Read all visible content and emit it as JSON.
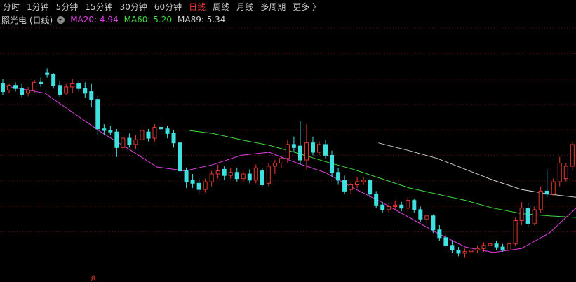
{
  "toolbar": {
    "tabs": [
      {
        "label": "分时"
      },
      {
        "label": "1分钟"
      },
      {
        "label": "5分钟"
      },
      {
        "label": "15分钟"
      },
      {
        "label": "30分钟"
      },
      {
        "label": "60分钟"
      },
      {
        "label": "日线",
        "active": true
      },
      {
        "label": "周线"
      },
      {
        "label": "月线"
      },
      {
        "label": "多周期"
      },
      {
        "label": "更多 〉"
      }
    ]
  },
  "info": {
    "stock_label": "照光电 (日线)",
    "ma20": {
      "label": "MA20: 4.94",
      "color": "#e040e0"
    },
    "ma60": {
      "label": "MA60: 5.20",
      "color": "#3fd93f"
    },
    "ma89": {
      "label": "MA89: 5.34",
      "color": "#cfcfcf"
    }
  },
  "colors": {
    "up": "#e8382f",
    "down": "#3ee0e0",
    "grid": "#7a1010"
  },
  "chart_data": {
    "type": "candlestick",
    "candles": [
      [
        6.22,
        6.28,
        6.08,
        6.12
      ],
      [
        6.14,
        6.22,
        6.1,
        6.2
      ],
      [
        6.2,
        6.24,
        6.12,
        6.16
      ],
      [
        6.16,
        6.22,
        6.05,
        6.08
      ],
      [
        6.1,
        6.18,
        6.06,
        6.14
      ],
      [
        6.14,
        6.27,
        6.1,
        6.24
      ],
      [
        6.24,
        6.3,
        6.18,
        6.22
      ],
      [
        6.36,
        6.42,
        6.3,
        6.34
      ],
      [
        6.34,
        6.36,
        6.16,
        6.2
      ],
      [
        6.2,
        6.26,
        6.05,
        6.08
      ],
      [
        6.1,
        6.22,
        6.08,
        6.18
      ],
      [
        6.18,
        6.28,
        6.1,
        6.22
      ],
      [
        6.22,
        6.26,
        6.12,
        6.16
      ],
      [
        6.16,
        6.24,
        6.04,
        6.1
      ],
      [
        6.12,
        6.22,
        5.92,
        6.02
      ],
      [
        6.02,
        6.06,
        5.56,
        5.64
      ],
      [
        5.64,
        5.7,
        5.56,
        5.62
      ],
      [
        5.62,
        5.68,
        5.56,
        5.6
      ],
      [
        5.6,
        5.64,
        5.28,
        5.4
      ],
      [
        5.4,
        5.56,
        5.36,
        5.52
      ],
      [
        5.52,
        5.58,
        5.4,
        5.44
      ],
      [
        5.44,
        5.56,
        5.38,
        5.5
      ],
      [
        5.5,
        5.66,
        5.46,
        5.62
      ],
      [
        5.6,
        5.64,
        5.48,
        5.52
      ],
      [
        5.52,
        5.7,
        5.48,
        5.66
      ],
      [
        5.66,
        5.72,
        5.6,
        5.64
      ],
      [
        5.64,
        5.68,
        5.52,
        5.58
      ],
      [
        5.58,
        5.62,
        5.4,
        5.46
      ],
      [
        5.46,
        5.48,
        5.02,
        5.1
      ],
      [
        5.1,
        5.14,
        4.88,
        4.96
      ],
      [
        4.98,
        5.06,
        4.88,
        4.94
      ],
      [
        4.94,
        5.0,
        4.8,
        4.86
      ],
      [
        4.86,
        5.0,
        4.82,
        4.96
      ],
      [
        4.96,
        5.1,
        4.9,
        5.06
      ],
      [
        5.06,
        5.18,
        5.0,
        5.1
      ],
      [
        5.12,
        5.16,
        4.98,
        5.04
      ],
      [
        5.04,
        5.14,
        5.0,
        5.08
      ],
      [
        5.08,
        5.14,
        4.96,
        5.0
      ],
      [
        5.0,
        5.1,
        4.96,
        5.06
      ],
      [
        5.06,
        5.12,
        4.94,
        4.98
      ],
      [
        4.98,
        5.18,
        4.94,
        5.14
      ],
      [
        5.1,
        5.14,
        4.9,
        4.92
      ],
      [
        4.94,
        5.2,
        4.9,
        5.16
      ],
      [
        5.16,
        5.24,
        5.06,
        5.2
      ],
      [
        5.2,
        5.3,
        5.14,
        5.26
      ],
      [
        5.26,
        5.5,
        5.2,
        5.44
      ],
      [
        5.44,
        5.54,
        5.34,
        5.4
      ],
      [
        5.42,
        5.74,
        5.18,
        5.24
      ],
      [
        5.24,
        5.7,
        5.12,
        5.46
      ],
      [
        5.46,
        5.54,
        5.3,
        5.34
      ],
      [
        5.34,
        5.48,
        5.3,
        5.44
      ],
      [
        5.44,
        5.5,
        5.26,
        5.3
      ],
      [
        5.3,
        5.36,
        5.02,
        5.08
      ],
      [
        5.08,
        5.14,
        4.92,
        4.98
      ],
      [
        4.98,
        5.04,
        4.8,
        4.84
      ],
      [
        4.86,
        4.96,
        4.8,
        4.92
      ],
      [
        4.92,
        5.02,
        4.88,
        4.96
      ],
      [
        4.96,
        5.02,
        4.92,
        4.98
      ],
      [
        4.98,
        5.0,
        4.76,
        4.8
      ],
      [
        4.8,
        4.84,
        4.62,
        4.66
      ],
      [
        4.66,
        4.7,
        4.56,
        4.6
      ],
      [
        4.6,
        4.68,
        4.56,
        4.64
      ],
      [
        4.64,
        4.72,
        4.6,
        4.66
      ],
      [
        4.66,
        4.7,
        4.58,
        4.62
      ],
      [
        4.62,
        4.76,
        4.6,
        4.72
      ],
      [
        4.72,
        4.74,
        4.56,
        4.6
      ],
      [
        4.6,
        4.64,
        4.44,
        4.48
      ],
      [
        4.48,
        4.54,
        4.4,
        4.52
      ],
      [
        4.52,
        4.54,
        4.3,
        4.34
      ],
      [
        4.34,
        4.4,
        4.2,
        4.24
      ],
      [
        4.24,
        4.3,
        4.1,
        4.14
      ],
      [
        4.14,
        4.2,
        4.04,
        4.08
      ],
      [
        4.08,
        4.12,
        4.0,
        4.04
      ],
      [
        4.04,
        4.1,
        3.98,
        4.06
      ],
      [
        4.06,
        4.12,
        4.02,
        4.08
      ],
      [
        4.08,
        4.14,
        4.04,
        4.1
      ],
      [
        4.1,
        4.18,
        4.06,
        4.14
      ],
      [
        4.14,
        4.2,
        4.1,
        4.16
      ],
      [
        4.16,
        4.2,
        4.08,
        4.12
      ],
      [
        4.12,
        4.16,
        4.06,
        4.08
      ],
      [
        4.08,
        4.18,
        4.04,
        4.16
      ],
      [
        4.16,
        4.5,
        4.14,
        4.46
      ],
      [
        4.46,
        4.7,
        4.4,
        4.62
      ],
      [
        4.62,
        4.68,
        4.38,
        4.42
      ],
      [
        4.42,
        4.64,
        4.4,
        4.6
      ],
      [
        4.6,
        4.9,
        4.56,
        4.84
      ],
      [
        4.84,
        5.12,
        4.76,
        4.8
      ],
      [
        4.8,
        5.0,
        4.78,
        4.96
      ],
      [
        4.96,
        5.28,
        4.9,
        5.2
      ],
      [
        5.0,
        5.2,
        4.96,
        5.16
      ],
      [
        5.16,
        5.48,
        5.1,
        5.44
      ],
      [
        5.44,
        5.58,
        5.3,
        5.34
      ]
    ],
    "ma20": [
      [
        0,
        6.2
      ],
      [
        30,
        6.1
      ],
      [
        50,
        5.85
      ],
      [
        70,
        5.6
      ],
      [
        90,
        5.38
      ],
      [
        110,
        5.15
      ],
      [
        130,
        5.1
      ],
      [
        150,
        5.18
      ],
      [
        170,
        5.3
      ],
      [
        190,
        5.34
      ],
      [
        210,
        5.2
      ],
      [
        230,
        5.08
      ],
      [
        250,
        4.88
      ],
      [
        270,
        4.7
      ],
      [
        290,
        4.5
      ],
      [
        310,
        4.3
      ],
      [
        330,
        4.12
      ],
      [
        350,
        4.05
      ],
      [
        370,
        4.1
      ],
      [
        390,
        4.3
      ],
      [
        409,
        4.62
      ]
    ],
    "ma60": [
      [
        133,
        5.62
      ],
      [
        150,
        5.58
      ],
      [
        170,
        5.5
      ],
      [
        190,
        5.43
      ],
      [
        210,
        5.33
      ],
      [
        230,
        5.22
      ],
      [
        250,
        5.12
      ],
      [
        270,
        5.0
      ],
      [
        290,
        4.88
      ],
      [
        310,
        4.8
      ],
      [
        330,
        4.72
      ],
      [
        350,
        4.62
      ],
      [
        370,
        4.55
      ],
      [
        390,
        4.52
      ],
      [
        409,
        4.5
      ]
    ],
    "ma89": [
      [
        268,
        5.46
      ],
      [
        290,
        5.36
      ],
      [
        310,
        5.26
      ],
      [
        330,
        5.12
      ],
      [
        350,
        4.98
      ],
      [
        370,
        4.86
      ],
      [
        390,
        4.8
      ],
      [
        409,
        4.76
      ]
    ],
    "price_min": 3.85,
    "price_max": 6.92
  }
}
